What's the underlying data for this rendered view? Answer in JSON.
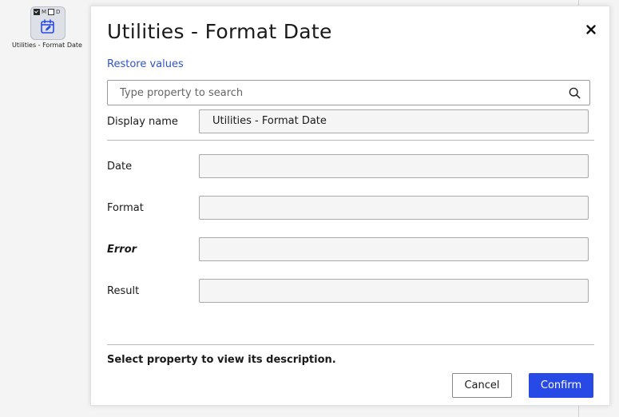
{
  "node": {
    "flags": [
      {
        "checked": true,
        "label": ""
      },
      {
        "checked": false,
        "label": "M"
      },
      {
        "checked": false,
        "label": "D"
      }
    ],
    "flag_m": "M",
    "flag_d": "D",
    "icon": "calendar-edit-icon",
    "label": "Utilities - Format Date"
  },
  "dialog": {
    "title": "Utilities - Format Date",
    "close_icon": "close-icon",
    "restore_label": "Restore values",
    "search": {
      "placeholder": "Type property to search",
      "value": "",
      "icon": "search-icon"
    },
    "display_name": {
      "label": "Display name",
      "value": "Utilities - Format Date"
    },
    "properties": [
      {
        "label": "Date",
        "value": ""
      },
      {
        "label": "Format",
        "value": ""
      },
      {
        "label": "Error",
        "value": ""
      },
      {
        "label": "Result",
        "value": ""
      }
    ],
    "description": "Select property to view its description.",
    "cancel_label": "Cancel",
    "confirm_label": "Confirm"
  },
  "colors": {
    "accent": "#2749e6",
    "link": "#2f54c9"
  }
}
